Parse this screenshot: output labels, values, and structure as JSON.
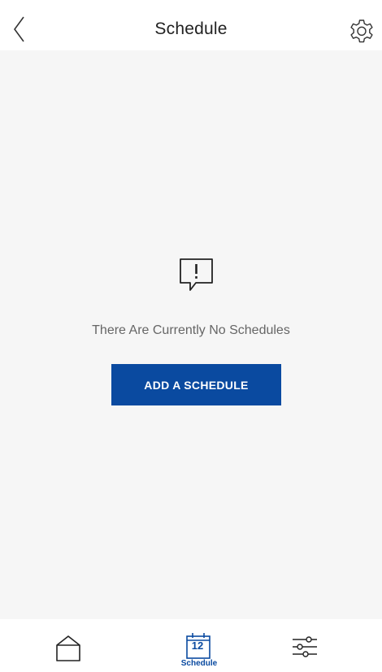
{
  "header": {
    "title": "Schedule",
    "back_icon": "chevron-left-icon",
    "settings_icon": "gear-icon"
  },
  "main": {
    "empty_icon": "alert-speech-bubble-icon",
    "empty_message": "There Are Currently No Schedules",
    "add_button_label": "ADD A SCHEDULE"
  },
  "tabbar": {
    "tabs": [
      {
        "icon": "home-icon",
        "label": "",
        "active": false
      },
      {
        "icon": "calendar-icon",
        "label": "Schedule",
        "calendar_day": "12",
        "active": true
      },
      {
        "icon": "sliders-icon",
        "label": "",
        "active": false
      }
    ]
  },
  "colors": {
    "accent": "#0a4aa0",
    "background": "#f6f6f6",
    "text_muted": "#666666"
  }
}
